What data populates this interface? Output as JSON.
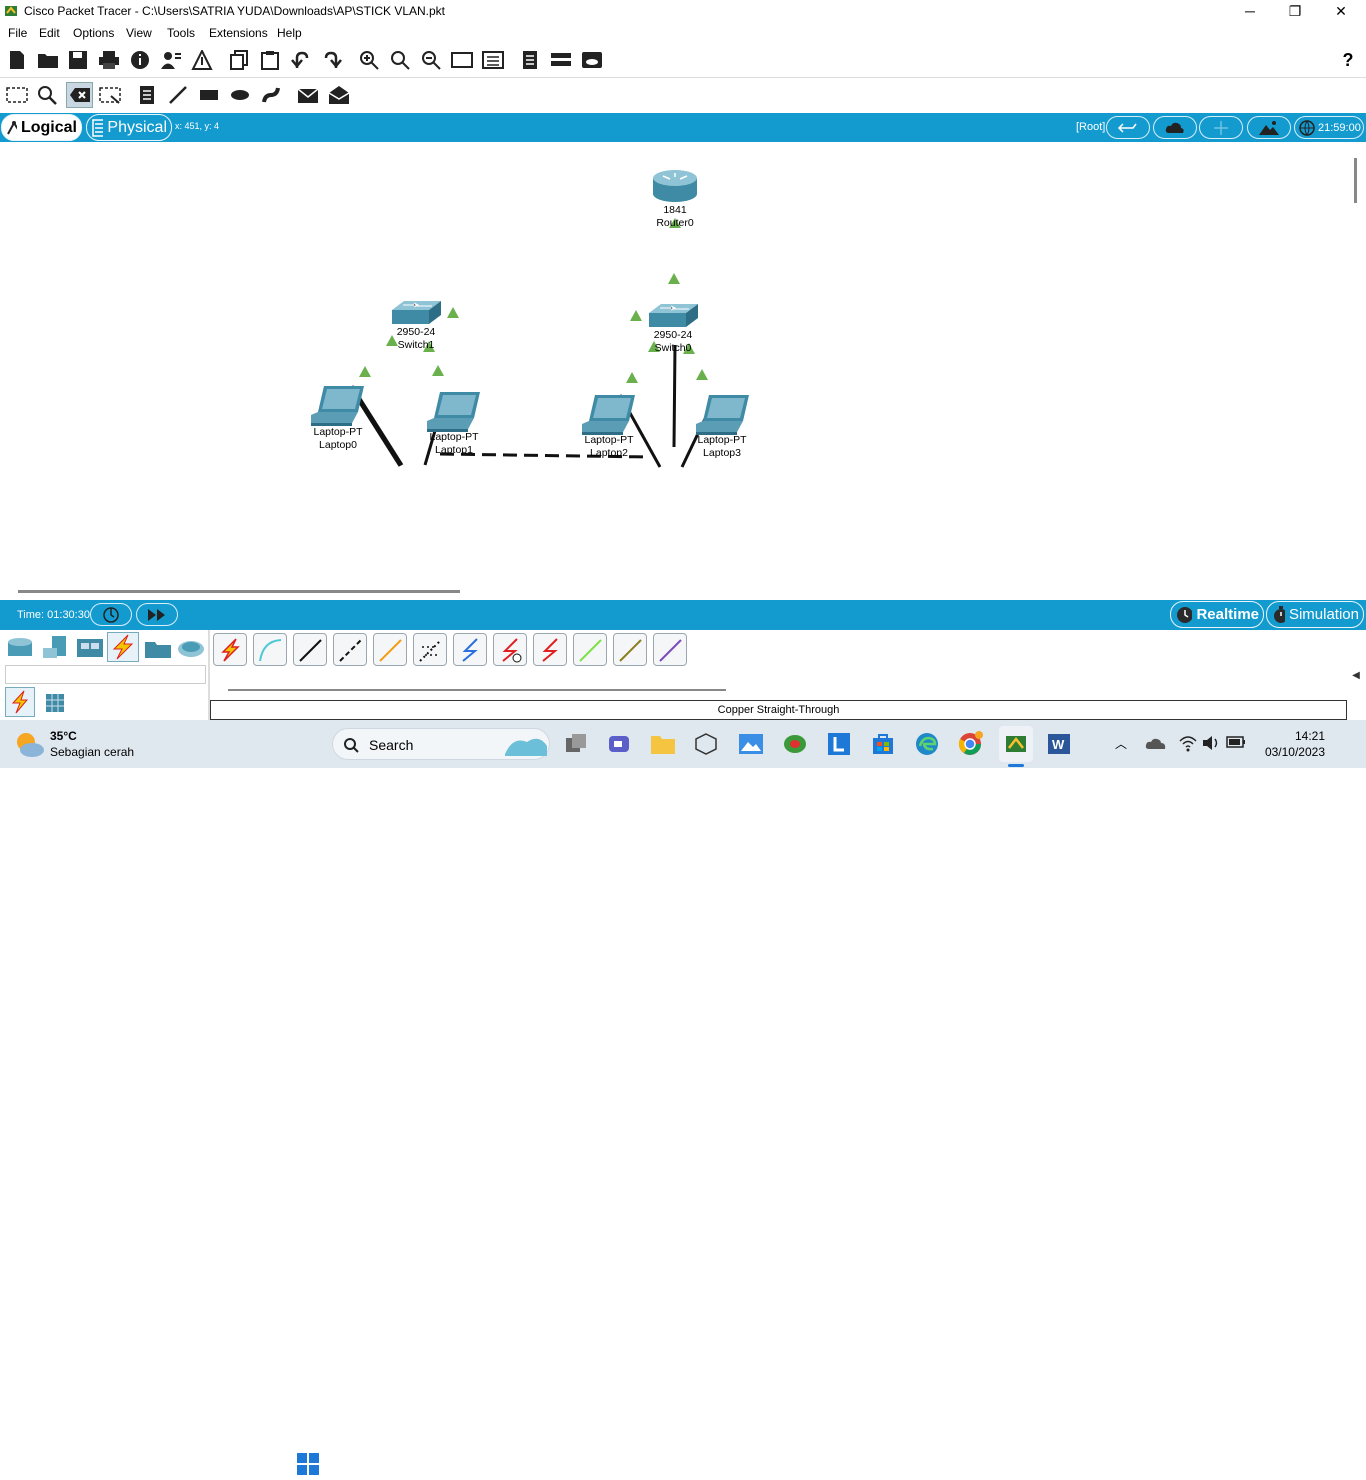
{
  "window": {
    "title": "Cisco Packet Tracer - C:\\Users\\SATRIA YUDA\\Downloads\\AP\\STICK VLAN.pkt",
    "minimize": "─",
    "maximize": "❐",
    "close": "✕"
  },
  "menu": [
    "File",
    "Edit",
    "Options",
    "View",
    "Tools",
    "Extensions",
    "Help"
  ],
  "toolbar": {
    "help_label": "?"
  },
  "modebar": {
    "logical": "Logical",
    "physical": "Physical",
    "coords": "x: 451, y: 4",
    "root": "[Root]",
    "clock": "21:59:00"
  },
  "devices": [
    {
      "model": "1841",
      "name": "Router0"
    },
    {
      "model": "2950-24",
      "name": "Switch1"
    },
    {
      "model": "2950-24",
      "name": "Switch0"
    },
    {
      "model": "Laptop-PT",
      "name": "Laptop0"
    },
    {
      "model": "Laptop-PT",
      "name": "Laptop1"
    },
    {
      "model": "Laptop-PT",
      "name": "Laptop2"
    },
    {
      "model": "Laptop-PT",
      "name": "Laptop3"
    }
  ],
  "sim": {
    "time": "Time: 01:30:30",
    "realtime": "Realtime",
    "simulation": "Simulation"
  },
  "connections_panel": {
    "selected_cable": "Copper Straight-Through"
  },
  "taskbar": {
    "weather_temp": "35°C",
    "weather_desc": "Sebagian cerah",
    "search": "Search",
    "time": "14:21",
    "date": "03/10/2023"
  },
  "colors": {
    "accent": "#139bd0",
    "link_up": "#6ab04c",
    "device": "#4a9bb5"
  }
}
